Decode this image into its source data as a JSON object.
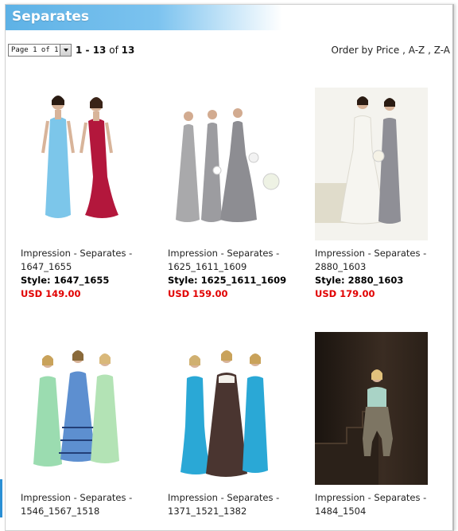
{
  "header": {
    "title": "Separates"
  },
  "pager": {
    "select_value": "Page 1 of 1",
    "range_start": "1",
    "range_sep": " - ",
    "range_end": "13",
    "of_label": " of ",
    "total": "13"
  },
  "ordering": {
    "prefix": "Order by",
    "price": "Price",
    "sep1": " , ",
    "az": "A-Z",
    "sep2": " , ",
    "za": "Z-A"
  },
  "products": [
    {
      "title": "Impression - Separates - 1647_1655",
      "style": "Style: 1647_1655",
      "price": "USD 149.00"
    },
    {
      "title": "Impression - Separates - 1625_1611_1609",
      "style": "Style: 1625_1611_1609",
      "price": "USD 159.00"
    },
    {
      "title": "Impression - Separates - 2880_1603",
      "style": "Style: 2880_1603",
      "price": "USD 179.00"
    },
    {
      "title": "Impression - Separates - 1546_1567_1518",
      "style": "",
      "price": ""
    },
    {
      "title": "Impression - Separates - 1371_1521_1382",
      "style": "",
      "price": ""
    },
    {
      "title": "Impression - Separates - 1484_1504",
      "style": "",
      "price": ""
    }
  ],
  "colors": {
    "header_blue": "#5eb2e6",
    "price_red": "#e10000"
  }
}
